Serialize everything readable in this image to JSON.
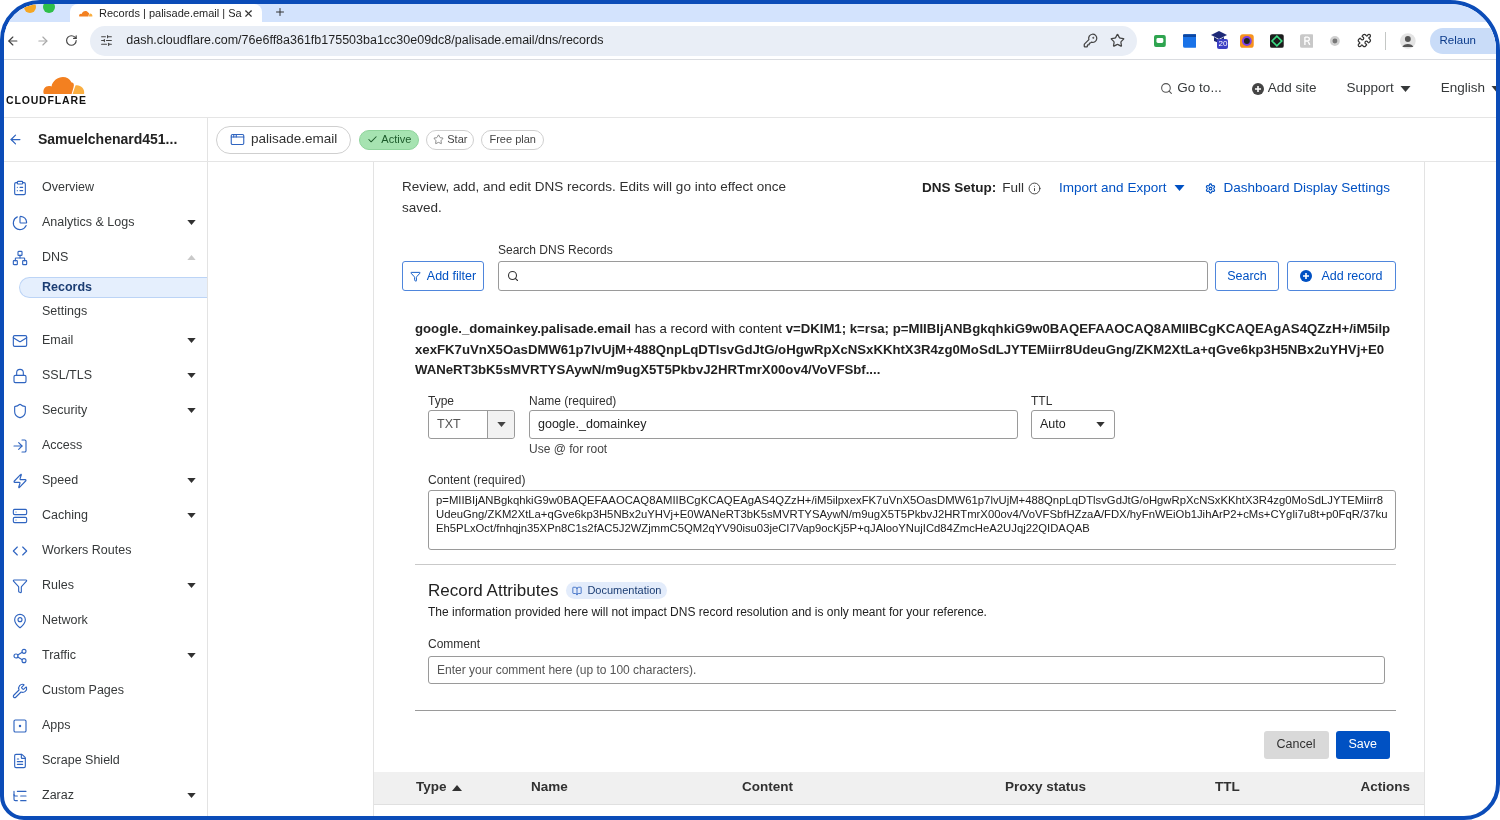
{
  "browser": {
    "tab_title": "Records | palisade.email | Sa",
    "url": "dash.cloudflare.com/76e6ff8a361fb175503ba1cc30e09dc8/palisade.email/dns/records",
    "extension_badge": "20",
    "relaunch_button": "Relaun"
  },
  "header": {
    "logo_text": "CLOUDFLARE",
    "nav": [
      {
        "label": "Go to...",
        "kind": "search"
      },
      {
        "label": "Add site",
        "kind": "add"
      },
      {
        "label": "Support",
        "kind": "menu"
      },
      {
        "label": "English",
        "kind": "menu"
      }
    ]
  },
  "account": {
    "name": "Samuelchenard451..."
  },
  "zone": {
    "domain": "palisade.email",
    "status": "Active",
    "star": "Star",
    "plan": "Free plan"
  },
  "sidebar": {
    "items": [
      {
        "label": "Overview",
        "kind": "link",
        "selected": false
      },
      {
        "label": "Analytics & Logs",
        "kind": "group",
        "expanded": false,
        "selected": false
      },
      {
        "label": "DNS",
        "kind": "group",
        "expanded": true,
        "selected": false,
        "children": [
          {
            "label": "Records",
            "selected": true
          },
          {
            "label": "Settings",
            "selected": false
          }
        ]
      },
      {
        "label": "Email",
        "kind": "group",
        "expanded": false,
        "selected": false
      },
      {
        "label": "SSL/TLS",
        "kind": "group",
        "expanded": false,
        "selected": false
      },
      {
        "label": "Security",
        "kind": "group",
        "expanded": false,
        "selected": false
      },
      {
        "label": "Access",
        "kind": "link",
        "selected": false
      },
      {
        "label": "Speed",
        "kind": "group",
        "expanded": false,
        "selected": false
      },
      {
        "label": "Caching",
        "kind": "group",
        "expanded": false,
        "selected": false
      },
      {
        "label": "Workers Routes",
        "kind": "link",
        "selected": false
      },
      {
        "label": "Rules",
        "kind": "group",
        "expanded": false,
        "selected": false
      },
      {
        "label": "Network",
        "kind": "link",
        "selected": false
      },
      {
        "label": "Traffic",
        "kind": "group",
        "expanded": false,
        "selected": false
      },
      {
        "label": "Custom Pages",
        "kind": "link",
        "selected": false
      },
      {
        "label": "Apps",
        "kind": "link",
        "selected": false
      },
      {
        "label": "Scrape Shield",
        "kind": "link",
        "selected": false
      },
      {
        "label": "Zaraz",
        "kind": "group",
        "expanded": false,
        "selected": false
      }
    ]
  },
  "dns_page": {
    "intro": "Review, add, and edit DNS records. Edits will go into effect once saved.",
    "dns_setup_label": "DNS Setup:",
    "dns_setup_value": "Full",
    "import_export": "Import and Export",
    "display_settings": "Dashboard Display Settings",
    "search": {
      "label": "Search DNS Records"
    },
    "add_filter": "Add filter",
    "search_button": "Search",
    "add_record": "Add record",
    "record_summary": "**google._domainkey.palisade.email** has a record with content **v=DKIM1; k=rsa; p=MIIBIjANBgkqhkiG9w0BAQEFAAOCAQ8AMIIBCgKCAQEAgAS4QZzH+/iM5ilpxexFK7uVnX5OasDMW61p7lvUjM+488QnpLqDTlsvGdJtG/oHgwRpXcNSxKKhtX3R4zg0MoSdLJYTEMiirr8UdeuGng/ZKM2XtLa+qGve6kp3H5NBx2uYHVj+E0WANeRT3bK5sMVRTYSAywN/m9ugX5T5PkbvJ2HRTmrX00ov4/VoVFSbf....**",
    "form": {
      "type": {
        "label": "Type",
        "value": "TXT"
      },
      "name": {
        "label": "Name (required)",
        "value": "google._domainkey",
        "hint": "Use @ for root"
      },
      "ttl": {
        "label": "TTL",
        "value": "Auto"
      },
      "content": {
        "label": "Content (required)",
        "value": "p=MIIBIjANBgkqhkiG9w0BAQEFAAOCAQ8AMIIBCgKCAQEAgAS4QZzH+/iM5ilpxexFK7uVnX5OasDMW61p7lvUjM+488QnpLqDTlsvGdJtG/oHgwRpXcNSxKKhtX3R4zg0MoSdLJYTEMiirr8UdeuGng/ZKM2XtLa+qGve6kp3H5NBx2uYHVj+E0WANeRT3bK5sMVRTYSAywN/m9ugX5T5PkbvJ2HRTmrX00ov4/VoVFSbfHZzaA/FDX/hyFnWEiOb1JihArP2+cMs+CYgli7u8t+p0FqR/37kuEh5PLxOct/fnhqjn35XPn8C1s2fAC5J2WZjmmC5QM2qYV90isu03jeCI7Vap9ocKj5P+qJAlooYNujICd84ZmcHeA2UJqj22QIDAQAB"
      }
    },
    "attributes": {
      "title": "Record Attributes",
      "doc_link": "Documentation",
      "description": "The information provided here will not impact DNS record resolution and is only meant for your reference.",
      "comment": {
        "label": "Comment",
        "placeholder": "Enter your comment here (up to 100 characters)."
      }
    },
    "actions": [
      {
        "label": "Cancel",
        "kind": "secondary"
      },
      {
        "label": "Save",
        "kind": "primary"
      }
    ],
    "table": {
      "columns": [
        {
          "label": "Type",
          "sorted": true
        },
        {
          "label": "Name",
          "sorted": false
        },
        {
          "label": "Content",
          "sorted": false
        },
        {
          "label": "Proxy status",
          "sorted": false
        },
        {
          "label": "TTL",
          "sorted": false
        },
        {
          "label": "Actions",
          "sorted": false
        }
      ]
    }
  }
}
